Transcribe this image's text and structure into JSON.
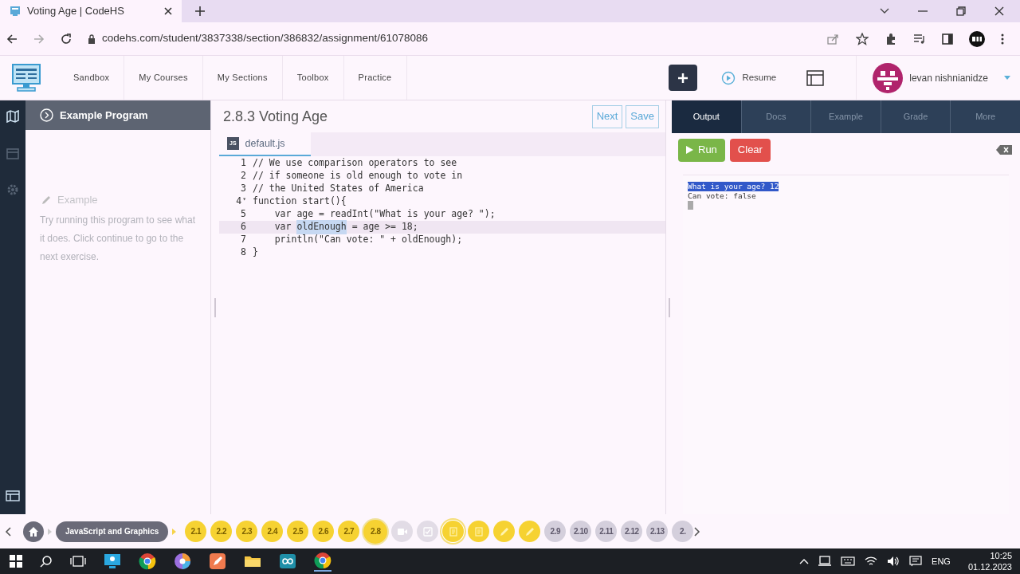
{
  "browser": {
    "tab_title": "Voting Age | CodeHS",
    "url": "codehs.com/student/3837338/section/386832/assignment/61078086"
  },
  "nav": {
    "links": [
      "Sandbox",
      "My Courses",
      "My Sections",
      "Toolbox",
      "Practice"
    ],
    "resume": "Resume",
    "user": "levan nishnianidze"
  },
  "left_panel": {
    "header": "Example Program",
    "section_label": "Example",
    "description": "Try running this program to see what it does. Click continue to go to the next exercise."
  },
  "editor": {
    "title": "2.8.3 Voting Age",
    "buttons": [
      "Next",
      "Save"
    ],
    "file_tab": "default.js",
    "file_badge": "JS",
    "lines": [
      {
        "number": "1",
        "active": false,
        "segments": [
          {
            "text": "// We use comparison operators to see",
            "selected": false
          }
        ]
      },
      {
        "number": "2",
        "active": false,
        "segments": [
          {
            "text": "// if someone is old enough to vote in",
            "selected": false
          }
        ]
      },
      {
        "number": "3",
        "active": false,
        "segments": [
          {
            "text": "// the United States of America",
            "selected": false
          }
        ]
      },
      {
        "number": "4",
        "fold": "▾",
        "active": false,
        "segments": [
          {
            "text": "function start(){",
            "selected": false
          }
        ]
      },
      {
        "number": "5",
        "active": false,
        "segments": [
          {
            "text": "    var age = readInt(\"What is your age? \");",
            "selected": false
          }
        ]
      },
      {
        "number": "6",
        "active": true,
        "segments": [
          {
            "text": "    var ",
            "selected": false
          },
          {
            "text": "oldEnough",
            "selected": true
          },
          {
            "text": " = age >= 18;",
            "selected": false
          }
        ]
      },
      {
        "number": "7",
        "active": false,
        "segments": [
          {
            "text": "    println(\"Can vote: \" + oldEnough);",
            "selected": false
          }
        ]
      },
      {
        "number": "8",
        "active": false,
        "segments": [
          {
            "text": "}",
            "selected": false
          }
        ]
      }
    ]
  },
  "right_panel": {
    "tabs": [
      {
        "label": "Output",
        "selected": true
      },
      {
        "label": "Docs",
        "selected": false
      },
      {
        "label": "Example",
        "selected": false
      },
      {
        "label": "Grade",
        "selected": false
      },
      {
        "label": "More",
        "selected": false
      }
    ],
    "run": "Run",
    "clear": "Clear",
    "console": [
      {
        "text": "What is your age? 12",
        "selected": true
      },
      {
        "text": "Can vote: false",
        "selected": false
      }
    ]
  },
  "progress": {
    "course": "JavaScript and Graphics",
    "items": [
      {
        "kind": "lesson",
        "label": "2.1",
        "completed": true,
        "selected": false
      },
      {
        "kind": "lesson",
        "label": "2.2",
        "completed": true,
        "selected": false
      },
      {
        "kind": "lesson",
        "label": "2.3",
        "completed": true,
        "selected": false
      },
      {
        "kind": "lesson",
        "label": "2.4",
        "completed": true,
        "selected": false
      },
      {
        "kind": "lesson",
        "label": "2.5",
        "completed": true,
        "selected": false
      },
      {
        "kind": "lesson",
        "label": "2.6",
        "completed": true,
        "selected": false
      },
      {
        "kind": "lesson",
        "label": "2.7",
        "completed": true,
        "selected": false
      },
      {
        "kind": "lesson",
        "label": "2.8",
        "completed": true,
        "selected": true
      },
      {
        "kind": "video",
        "completed": false,
        "selected": false
      },
      {
        "kind": "quiz",
        "completed": false,
        "selected": false
      },
      {
        "kind": "example",
        "completed": true,
        "selected": true
      },
      {
        "kind": "example",
        "completed": true,
        "selected": false
      },
      {
        "kind": "exercise",
        "completed": true,
        "selected": false
      },
      {
        "kind": "exercise",
        "completed": true,
        "selected": false
      },
      {
        "kind": "lesson",
        "label": "2.9",
        "completed": false,
        "selected": false
      },
      {
        "kind": "lesson",
        "label": "2.10",
        "completed": false,
        "selected": false
      },
      {
        "kind": "lesson",
        "label": "2.11",
        "completed": false,
        "selected": false
      },
      {
        "kind": "lesson",
        "label": "2.12",
        "completed": false,
        "selected": false
      },
      {
        "kind": "lesson",
        "label": "2.13",
        "completed": false,
        "selected": false
      },
      {
        "kind": "lesson",
        "label": "2.",
        "completed": false,
        "selected": false
      }
    ]
  },
  "taskbar": {
    "language": "ENG",
    "time": "10:25",
    "date": "01.12.2023"
  }
}
